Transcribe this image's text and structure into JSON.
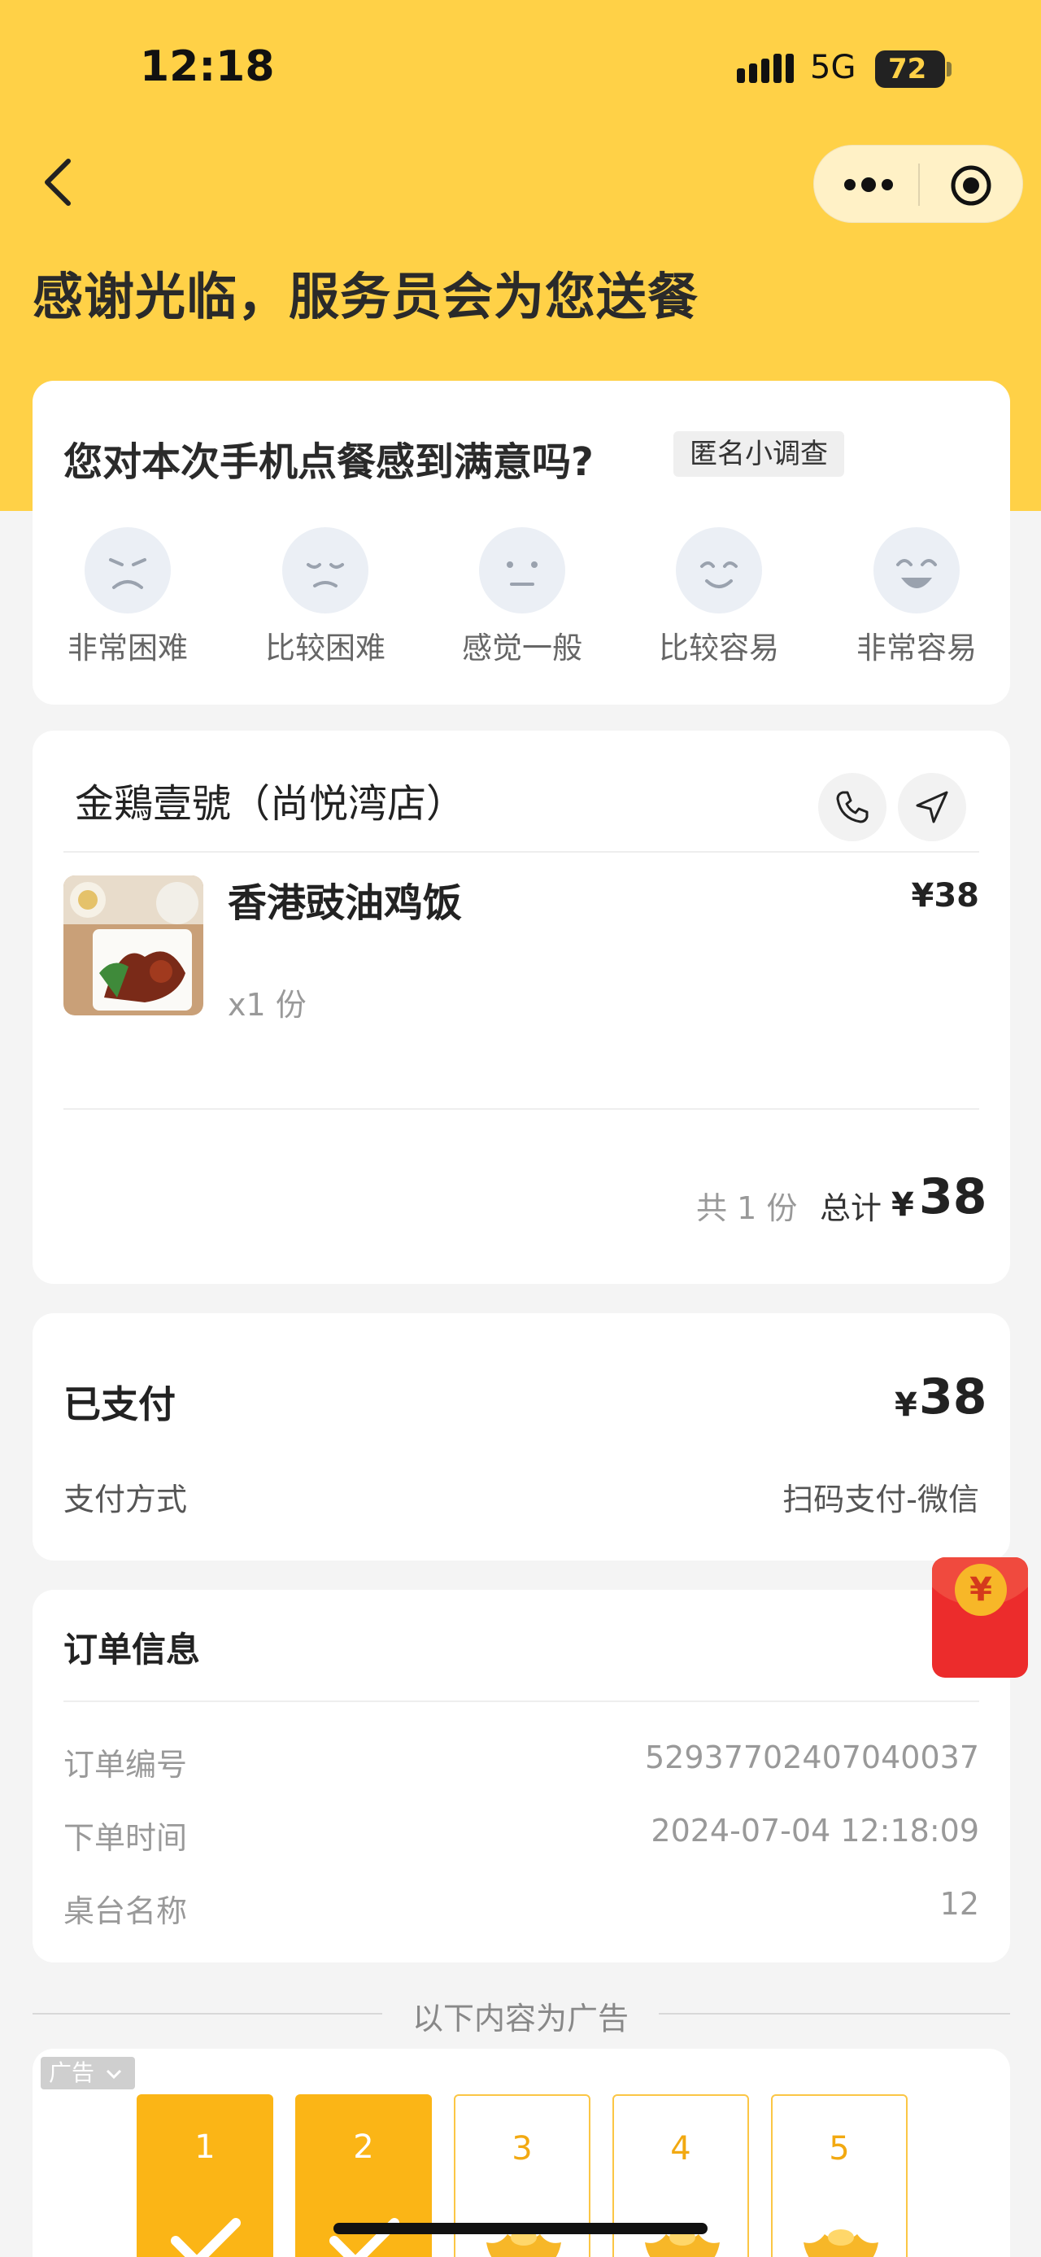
{
  "status_bar": {
    "time": "12:18",
    "network": "5G",
    "battery": "72"
  },
  "header": {
    "title": "感谢光临，服务员会为您送餐"
  },
  "survey": {
    "question": "您对本次手机点餐感到满意吗?",
    "tag": "匿名小调查",
    "options": [
      {
        "label": "非常困难",
        "icon": "very-hard-face-icon"
      },
      {
        "label": "比较困难",
        "icon": "hard-face-icon"
      },
      {
        "label": "感觉一般",
        "icon": "neutral-face-icon"
      },
      {
        "label": "比较容易",
        "icon": "easy-face-icon"
      },
      {
        "label": "非常容易",
        "icon": "very-easy-face-icon"
      }
    ]
  },
  "store": {
    "name": "金鶏壹號（尚悦湾店）",
    "items": [
      {
        "name": "香港豉油鸡饭",
        "price": "¥38",
        "qty": "x1 份"
      }
    ],
    "summary": {
      "count": "共 1 份",
      "total_label": "总计",
      "currency": "¥",
      "total": "38"
    }
  },
  "payment": {
    "status": "已支付",
    "currency": "¥",
    "amount": "38",
    "method_label": "支付方式",
    "method_value": "扫码支付-微信"
  },
  "order_info": {
    "title": "订单信息",
    "rows": [
      {
        "label": "订单编号",
        "value": "52937702407040037"
      },
      {
        "label": "下单时间",
        "value": "2024-07-04 12:18:09"
      },
      {
        "label": "桌台名称",
        "value": "12"
      }
    ]
  },
  "red_packet": {
    "symbol": "¥"
  },
  "ads": {
    "divider": "以下内容为广告",
    "tag": "广告",
    "steps": [
      {
        "num": "1",
        "state": "done"
      },
      {
        "num": "2",
        "state": "done"
      },
      {
        "num": "3",
        "state": "todo"
      },
      {
        "num": "4",
        "state": "todo"
      },
      {
        "num": "5",
        "state": "todo"
      }
    ]
  },
  "colors": {
    "brand": "#ffd147",
    "accent": "#fbb516",
    "red_packet": "#ec2c2c"
  }
}
